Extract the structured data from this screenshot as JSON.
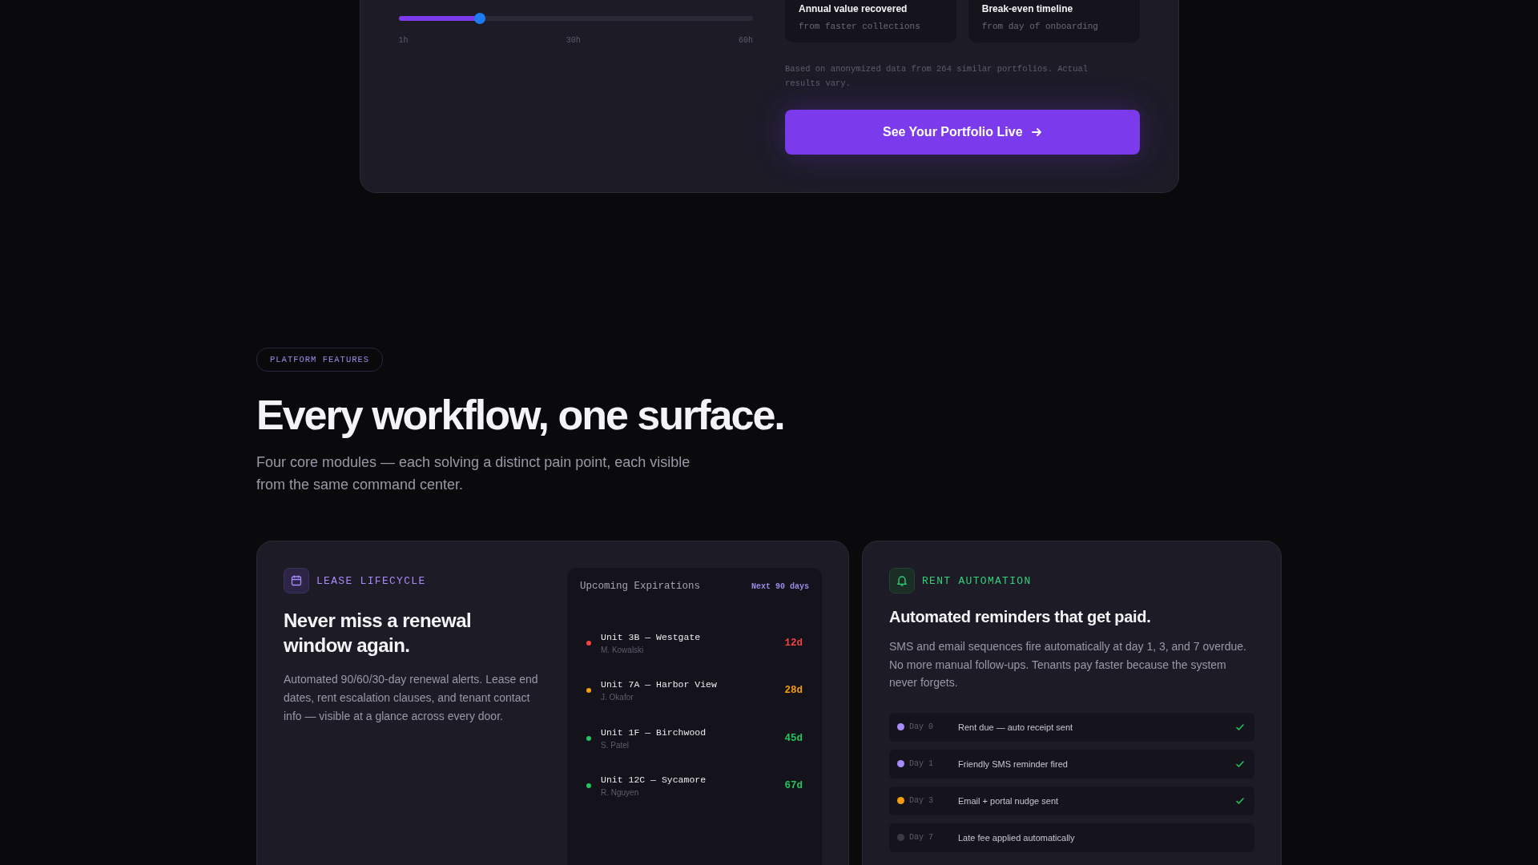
{
  "calculator": {
    "slider": {
      "level": 0.23,
      "ticks": [
        "1h",
        "30h",
        "60h"
      ]
    },
    "stats": [
      {
        "title": "Annual value recovered",
        "sub": "from faster collections"
      },
      {
        "title": "Break-even timeline",
        "sub": "from day of onboarding"
      }
    ],
    "note": "Based on anonymized data from 264 similar portfolios. Actual results vary.",
    "cta": "See Your Portfolio Live"
  },
  "features": {
    "pill": "PLATFORM FEATURES",
    "heading": "Every workflow, one surface.",
    "intro": "Four core modules — each solving a distinct pain point, each visible from the same command center."
  },
  "lease": {
    "label": "LEASE LIFECYCLE",
    "heading": "Never miss a renewal window again.",
    "text": "Automated 90/60/30-day renewal alerts. Lease end dates, rent escalation clauses, and tenant contact info — visible at a glance across every door.",
    "panel": {
      "title": "Upcoming Expirations",
      "range": "Next 90 days",
      "items": [
        {
          "unit": "Unit 3B — Westgate",
          "tenant": "M. Kowalski",
          "days": "12d",
          "color": "#ef4444"
        },
        {
          "unit": "Unit 7A — Harbor View",
          "tenant": "J. Okafor",
          "days": "28d",
          "color": "#f59e0b"
        },
        {
          "unit": "Unit 1F — Birchwood",
          "tenant": "S. Patel",
          "days": "45d",
          "color": "#22c55e"
        },
        {
          "unit": "Unit 12C — Sycamore",
          "tenant": "R. Nguyen",
          "days": "67d",
          "color": "#22c55e"
        }
      ]
    }
  },
  "rent": {
    "label": "RENT AUTOMATION",
    "heading": "Automated reminders that get paid.",
    "text": "SMS and email sequences fire automatically at day 1, 3, and 7 overdue. No more manual follow-ups. Tenants pay faster because the system never forgets.",
    "steps": [
      {
        "day": "Day 0",
        "text": "Rent due — auto receipt sent",
        "color": "#a78bfa",
        "done": true
      },
      {
        "day": "Day 1",
        "text": "Friendly SMS reminder fired",
        "color": "#a78bfa",
        "done": true
      },
      {
        "day": "Day 3",
        "text": "Email + portal nudge sent",
        "color": "#f59e0b",
        "done": true
      },
      {
        "day": "Day 7",
        "text": "Late fee applied automatically",
        "color": "#3a3946",
        "done": false
      }
    ]
  }
}
